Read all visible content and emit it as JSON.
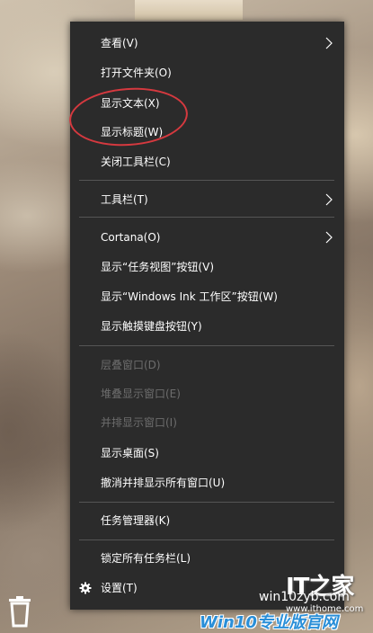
{
  "menu": {
    "items": [
      {
        "label": "查看(V)",
        "submenu": true,
        "disabled": false
      },
      {
        "label": "打开文件夹(O)",
        "submenu": false,
        "disabled": false
      },
      {
        "label": "显示文本(X)",
        "submenu": false,
        "disabled": false
      },
      {
        "label": "显示标题(W)",
        "submenu": false,
        "disabled": false
      },
      {
        "label": "关闭工具栏(C)",
        "submenu": false,
        "disabled": false
      },
      {
        "label": "工具栏(T)",
        "submenu": true,
        "disabled": false
      },
      {
        "label": "Cortana(O)",
        "submenu": true,
        "disabled": false
      },
      {
        "label": "显示“任务视图”按钮(V)",
        "submenu": false,
        "disabled": false
      },
      {
        "label": "显示“Windows Ink 工作区”按钮(W)",
        "submenu": false,
        "disabled": false
      },
      {
        "label": "显示触摸键盘按钮(Y)",
        "submenu": false,
        "disabled": false
      },
      {
        "label": "层叠窗口(D)",
        "submenu": false,
        "disabled": true
      },
      {
        "label": "堆叠显示窗口(E)",
        "submenu": false,
        "disabled": true
      },
      {
        "label": "并排显示窗口(I)",
        "submenu": false,
        "disabled": true
      },
      {
        "label": "显示桌面(S)",
        "submenu": false,
        "disabled": false
      },
      {
        "label": "撤消并排显示所有窗口(U)",
        "submenu": false,
        "disabled": false
      },
      {
        "label": "任务管理器(K)",
        "submenu": false,
        "disabled": false
      },
      {
        "label": "锁定所有任务栏(L)",
        "submenu": false,
        "disabled": false
      },
      {
        "label": "设置(T)",
        "submenu": false,
        "disabled": false,
        "icon": "gear-icon"
      }
    ]
  },
  "watermark": {
    "logo": "IT之家",
    "site": "win10zyb.com",
    "ithome": "www.ithome.com",
    "brand": "Win10专业版官网"
  },
  "colors": {
    "menu_bg": "#2b2b2b",
    "menu_text": "#ffffff",
    "disabled_text": "#6d6d6d",
    "separator": "#555555",
    "annotation": "#d5393f"
  }
}
